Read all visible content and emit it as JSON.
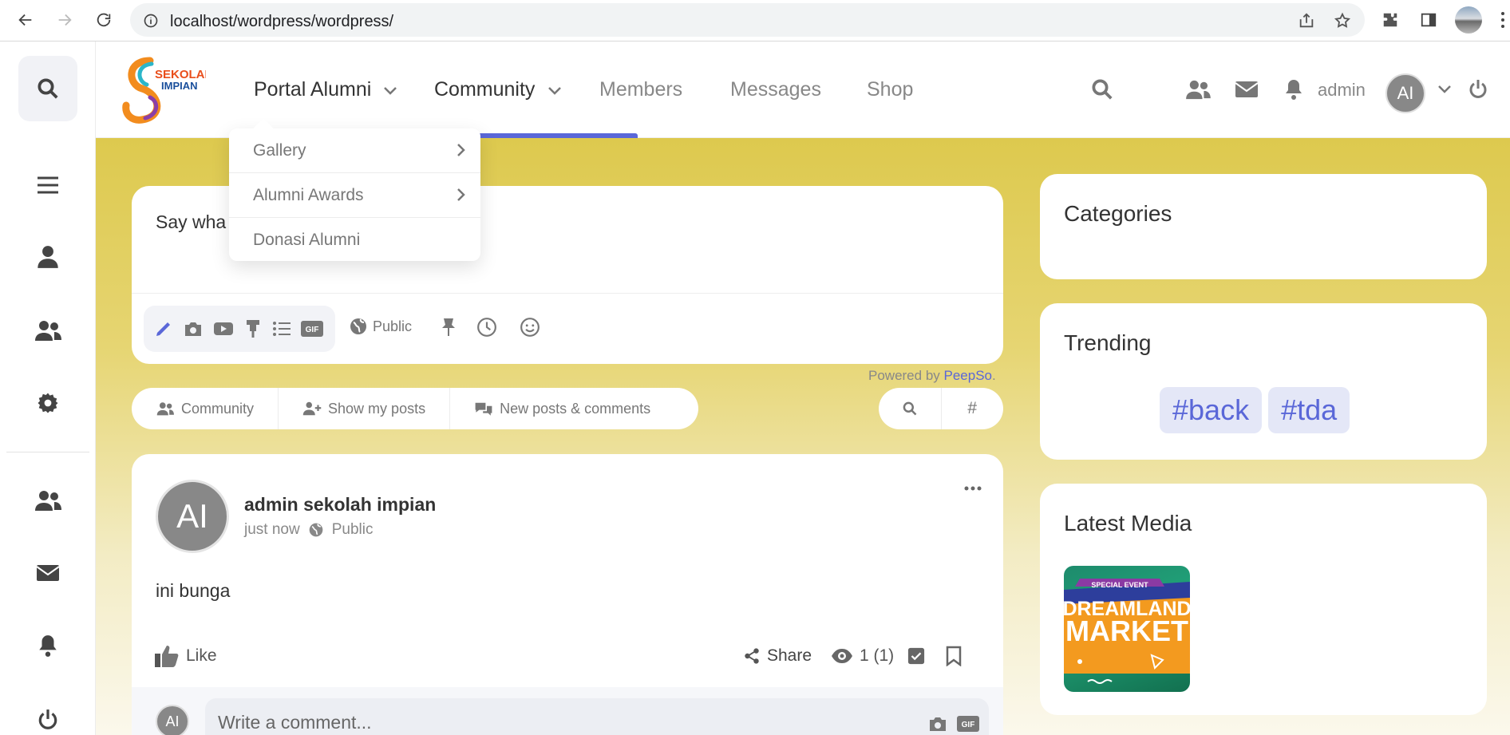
{
  "browser": {
    "url": "localhost/wordpress/wordpress/"
  },
  "logo": {
    "line1": "SEKOLAH",
    "line2": "IMPIAN"
  },
  "nav": {
    "items": [
      {
        "label": "Portal Alumni"
      },
      {
        "label": "Community"
      },
      {
        "label": "Members"
      },
      {
        "label": "Messages"
      },
      {
        "label": "Shop"
      }
    ],
    "user_name": "admin",
    "user_initials": "AI"
  },
  "dropdown": {
    "items": [
      {
        "label": "Gallery"
      },
      {
        "label": "Alumni Awards"
      },
      {
        "label": "Donasi Alumni"
      }
    ]
  },
  "postbox": {
    "placeholder": "Say wha",
    "privacy": "Public",
    "gif": "GIF",
    "powered_prefix": "Powered by",
    "powered_link": "PeepSo",
    "powered_suffix": "."
  },
  "filters": {
    "items": [
      {
        "label": "Community"
      },
      {
        "label": "Show my posts"
      },
      {
        "label": "New posts & comments"
      }
    ],
    "hashtag": "#"
  },
  "post": {
    "avatar_initials": "AI",
    "author": "admin sekolah impian",
    "time": "just now",
    "privacy": "Public",
    "body": "ini bunga",
    "like_label": "Like",
    "share_label": "Share",
    "views": "1 (1)",
    "comment_placeholder": "Write a comment...",
    "comment_avatar": "AI",
    "comment_gif": "GIF"
  },
  "widgets": {
    "categories_title": "Categories",
    "trending_title": "Trending",
    "trending_tags": [
      "#back",
      "#tda"
    ],
    "latest_media_title": "Latest Media",
    "media_text": {
      "tag": "SPECIAL EVENT",
      "line1": "DREAMLAND",
      "line2": "MARKET"
    }
  },
  "colors": {
    "accent": "#5a67d8",
    "background_gold": "#ddc94e"
  }
}
